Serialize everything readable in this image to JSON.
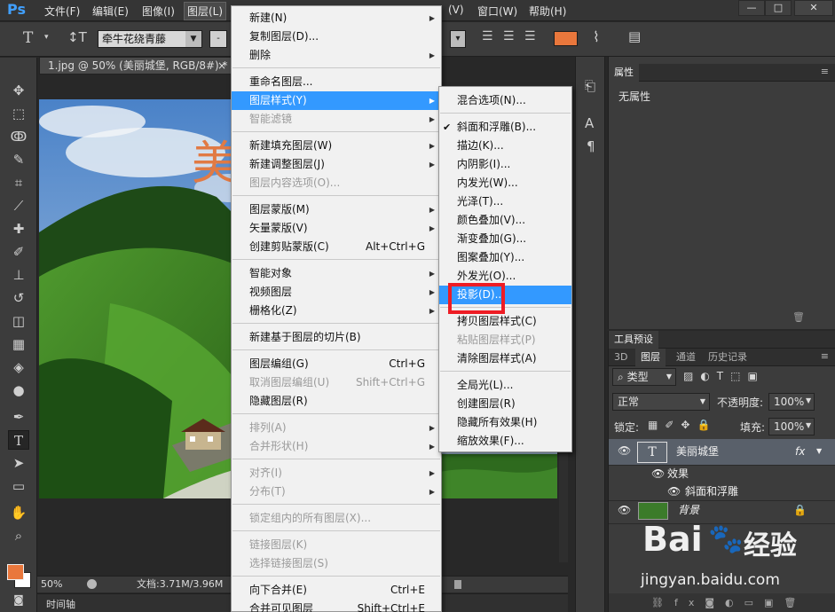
{
  "app": {
    "logo": "Ps"
  },
  "menubar": {
    "items": [
      "文件(F)",
      "编辑(E)",
      "图像(I)",
      "图层(L)",
      "(V)",
      "窗口(W)",
      "帮助(H)"
    ],
    "window_buttons": [
      "—",
      "□",
      "✕"
    ]
  },
  "options": {
    "font_family": "牵牛花绕青藤",
    "font_style": "-",
    "size_arrow": "▾"
  },
  "document": {
    "tab_title": "1.jpg @ 50% (美丽城堡, RGB/8#) *",
    "tab_close": "×",
    "canvas_text": "美",
    "zoom": "50%",
    "doc_info": "文档:3.71M/3.96M",
    "timeline": "时间轴"
  },
  "properties_panel": {
    "tab": "属性",
    "content": "无属性"
  },
  "layers_panel": {
    "tabs_top": [
      "工具预设"
    ],
    "tabs": [
      "3D",
      "图层",
      "通道",
      "历史记录"
    ],
    "filter_kind": "类型",
    "blend_mode": "正常",
    "opacity_label": "不透明度:",
    "opacity_value": "100%",
    "lock_label": "锁定:",
    "fill_label": "填充:",
    "fill_value": "100%",
    "layers": [
      {
        "name": "美丽城堡",
        "fx": "fx",
        "type_icon": "T"
      },
      {
        "name": "效果"
      },
      {
        "name": "斜面和浮雕"
      },
      {
        "name": "背景"
      }
    ]
  },
  "layer_menu": {
    "items": [
      {
        "label": "新建(N)",
        "sub": "▶"
      },
      {
        "label": "复制图层(D)..."
      },
      {
        "label": "删除",
        "sub": "▶"
      },
      {
        "label": "重命名图层..."
      },
      {
        "label": "图层样式(Y)",
        "sub": "▶"
      },
      {
        "label": "智能滤镜",
        "sub": "▶"
      },
      {
        "label": "新建填充图层(W)",
        "sub": "▶"
      },
      {
        "label": "新建调整图层(J)",
        "sub": "▶"
      },
      {
        "label": "图层内容选项(O)..."
      },
      {
        "label": "图层蒙版(M)",
        "sub": "▶"
      },
      {
        "label": "矢量蒙版(V)",
        "sub": "▶"
      },
      {
        "label": "创建剪贴蒙版(C)",
        "shortcut": "Alt+Ctrl+G"
      },
      {
        "label": "智能对象",
        "sub": "▶"
      },
      {
        "label": "视频图层",
        "sub": "▶"
      },
      {
        "label": "栅格化(Z)",
        "sub": "▶"
      },
      {
        "label": "新建基于图层的切片(B)"
      },
      {
        "label": "图层编组(G)",
        "shortcut": "Ctrl+G"
      },
      {
        "label": "取消图层编组(U)",
        "shortcut": "Shift+Ctrl+G"
      },
      {
        "label": "隐藏图层(R)"
      },
      {
        "label": "排列(A)",
        "sub": "▶"
      },
      {
        "label": "合并形状(H)",
        "sub": "▶"
      },
      {
        "label": "对齐(I)",
        "sub": "▶"
      },
      {
        "label": "分布(T)",
        "sub": "▶"
      },
      {
        "label": "锁定组内的所有图层(X)..."
      },
      {
        "label": "链接图层(K)"
      },
      {
        "label": "选择链接图层(S)"
      },
      {
        "label": "向下合并(E)",
        "shortcut": "Ctrl+E"
      },
      {
        "label": "合并可见图层",
        "shortcut": "Shift+Ctrl+E"
      }
    ]
  },
  "style_submenu": {
    "check": "✔",
    "items": [
      {
        "label": "混合选项(N)..."
      },
      {
        "label": "斜面和浮雕(B)..."
      },
      {
        "label": "描边(K)..."
      },
      {
        "label": "内阴影(I)..."
      },
      {
        "label": "内发光(W)..."
      },
      {
        "label": "光泽(T)..."
      },
      {
        "label": "颜色叠加(V)..."
      },
      {
        "label": "渐变叠加(G)..."
      },
      {
        "label": "图案叠加(Y)..."
      },
      {
        "label": "外发光(O)..."
      },
      {
        "label": "投影(D)..."
      },
      {
        "label": "拷贝图层样式(C)"
      },
      {
        "label": "粘贴图层样式(P)"
      },
      {
        "label": "清除图层样式(A)"
      },
      {
        "label": "全局光(L)..."
      },
      {
        "label": "创建图层(R)"
      },
      {
        "label": "隐藏所有效果(H)"
      },
      {
        "label": "缩放效果(F)..."
      }
    ]
  },
  "watermark": {
    "brand_left": "Bai",
    "brand_right": "经验",
    "url": "jingyan.baidu.com"
  },
  "colors": {
    "accent": "#3399ff",
    "foreground": "#e9773c",
    "highlight_box": "#ee1c24"
  }
}
